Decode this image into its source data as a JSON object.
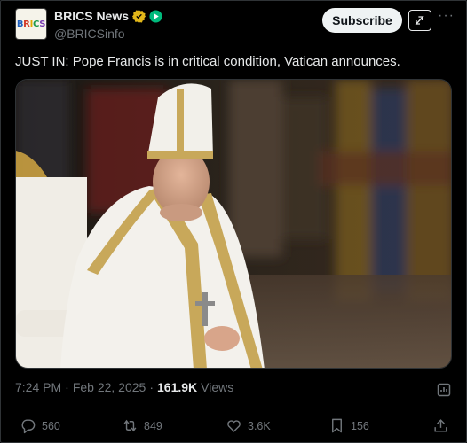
{
  "author": {
    "display_name": "BRICS News",
    "handle": "@BRICSinfo",
    "avatar_text": [
      "B",
      "R",
      "I",
      "C",
      "S"
    ]
  },
  "header": {
    "subscribe_label": "Subscribe",
    "more_icon": "more-horizontal-icon",
    "grok_icon": "grok-icon"
  },
  "tweet": {
    "text": "JUST IN: Pope Francis is in critical condition, Vatican announces."
  },
  "meta": {
    "time": "7:24 PM",
    "separator": "·",
    "date": "Feb 22, 2025",
    "views_count": "161.9K",
    "views_label": "Views"
  },
  "actions": {
    "replies": "560",
    "reposts": "849",
    "likes": "3.6K",
    "bookmarks": "156"
  },
  "colors": {
    "background": "#000000",
    "text": "#e7e9ea",
    "muted": "#71767b",
    "verified_gold": "#e2b719",
    "affiliate_green": "#00ba7c"
  }
}
